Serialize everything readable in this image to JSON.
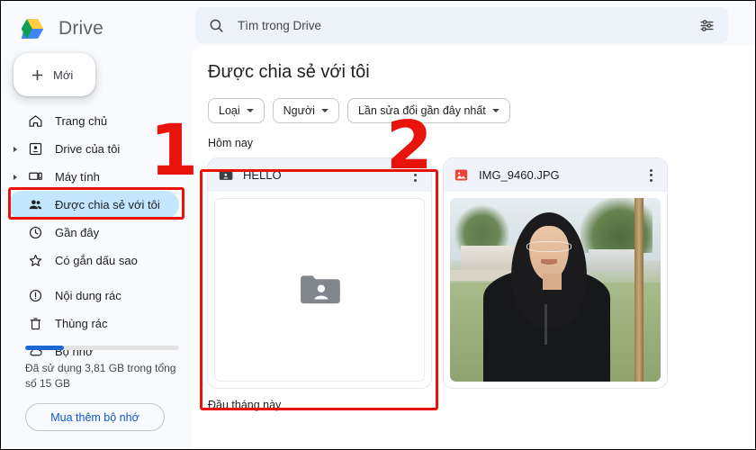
{
  "brand": {
    "name": "Drive",
    "logo_icon": "drive-logo-icon"
  },
  "new_button": {
    "label": "Mới",
    "icon": "plus-icon"
  },
  "search": {
    "placeholder": "Tìm trong Drive",
    "value": "",
    "search_icon": "search-icon",
    "tune_icon": "tune-icon"
  },
  "sidebar": {
    "items": [
      {
        "label": "Trang chủ",
        "icon": "home-icon",
        "active": false,
        "expandable": false
      },
      {
        "label": "Drive của tôi",
        "icon": "my-drive-icon",
        "active": false,
        "expandable": true
      },
      {
        "label": "Máy tính",
        "icon": "computers-icon",
        "active": false,
        "expandable": true
      },
      {
        "label": "Được chia sẻ với tôi",
        "icon": "shared-with-me-icon",
        "active": true,
        "expandable": false
      },
      {
        "label": "Gần đây",
        "icon": "recent-clock-icon",
        "active": false,
        "expandable": false
      },
      {
        "label": "Có gắn dấu sao",
        "icon": "star-icon",
        "active": false,
        "expandable": false
      },
      {
        "label": "Nội dung rác",
        "icon": "spam-icon",
        "active": false,
        "expandable": false
      },
      {
        "label": "Thùng rác",
        "icon": "trash-icon",
        "active": false,
        "expandable": false
      },
      {
        "label": "Bộ nhớ",
        "icon": "cloud-storage-icon",
        "active": false,
        "expandable": false
      }
    ],
    "storage": {
      "used_percent": 25,
      "text": "Đã sử dụng 3,81 GB trong tổng số 15 GB",
      "buy_label": "Mua thêm bộ nhớ",
      "bar_color": "#1967d2"
    }
  },
  "main": {
    "title": "Được chia sẻ với tôi",
    "chips": [
      {
        "label": "Loại",
        "caret": "chevron-down-icon"
      },
      {
        "label": "Người",
        "caret": "chevron-down-icon"
      },
      {
        "label": "Lần sửa đổi gần đây nhất",
        "caret": "chevron-down-icon"
      }
    ],
    "sections": [
      {
        "label": "Hôm nay"
      },
      {
        "label": "Đầu tháng này"
      }
    ],
    "cards": [
      {
        "name": "HELLO",
        "icon": "shared-folder-icon",
        "menu_icon": "more-vert-icon",
        "preview": "folder-placeholder"
      },
      {
        "name": "IMG_9460.JPG",
        "icon": "image-file-icon",
        "menu_icon": "more-vert-icon",
        "preview": "photo-portrait"
      }
    ]
  },
  "annotations": {
    "marker_one": "1",
    "marker_two": "2",
    "color": "#e8140c"
  }
}
